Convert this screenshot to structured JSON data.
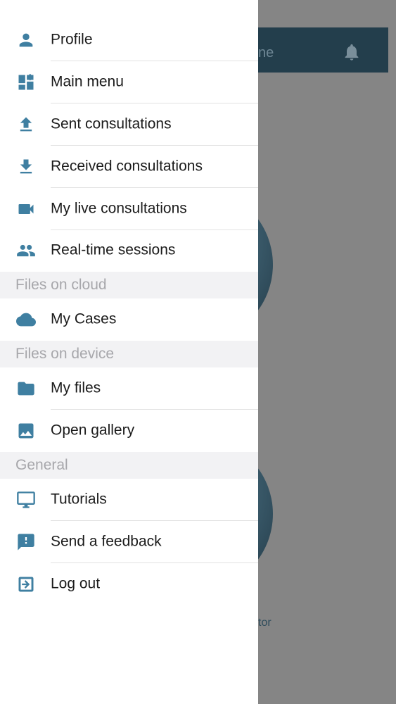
{
  "background": {
    "header_title_fragment": "ne",
    "caption_fragment": "tor"
  },
  "drawer": {
    "items_top": [
      {
        "label": "Profile",
        "icon": "person-icon"
      },
      {
        "label": "Main menu",
        "icon": "dashboard-icon"
      },
      {
        "label": "Sent consultations",
        "icon": "upload-icon"
      },
      {
        "label": "Received consultations",
        "icon": "download-icon"
      },
      {
        "label": "My live consultations",
        "icon": "videocam-icon"
      },
      {
        "label": "Real-time sessions",
        "icon": "people-icon"
      }
    ],
    "section_cloud": "Files on cloud",
    "items_cloud": [
      {
        "label": "My Cases",
        "icon": "cloud-icon"
      }
    ],
    "section_device": "Files on device",
    "items_device": [
      {
        "label": "My files",
        "icon": "folder-icon"
      },
      {
        "label": "Open gallery",
        "icon": "image-icon"
      }
    ],
    "section_general": "General",
    "items_general": [
      {
        "label": "Tutorials",
        "icon": "monitor-icon"
      },
      {
        "label": "Send a feedback",
        "icon": "feedback-icon"
      },
      {
        "label": "Log out",
        "icon": "logout-icon"
      }
    ]
  },
  "colors": {
    "icon": "#3f7fa1",
    "overlay": "#858585",
    "section_bg": "#f2f2f4",
    "section_text": "#a7a7ab"
  }
}
